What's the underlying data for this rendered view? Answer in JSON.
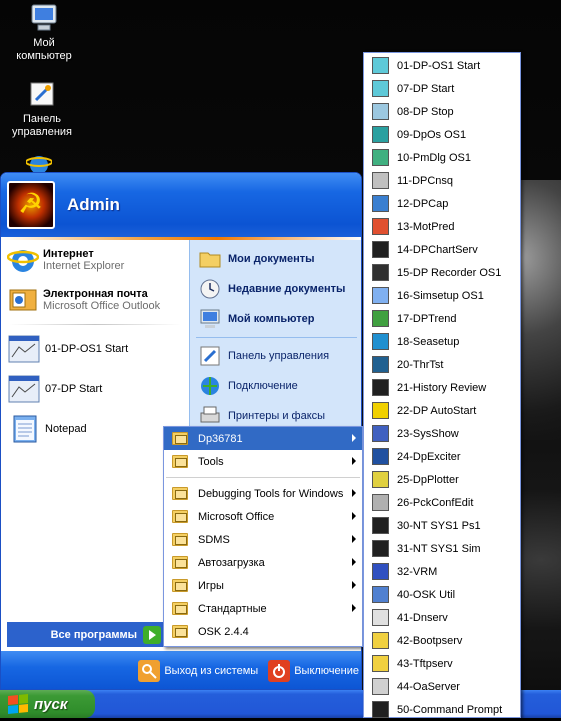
{
  "desktop": {
    "icons": [
      {
        "label": "Мой компьютер",
        "icon": "my-computer-icon"
      },
      {
        "label": "Панель управления",
        "icon": "control-panel-icon"
      }
    ]
  },
  "startmenu": {
    "user": "Admin",
    "pinned": [
      {
        "title": "Интернет",
        "subtitle": "Internet Explorer",
        "icon": "internet-explorer-icon"
      },
      {
        "title": "Электронная почта",
        "subtitle": "Microsoft Office Outlook",
        "icon": "outlook-icon"
      }
    ],
    "recent": [
      {
        "label": "01-DP-OS1 Start",
        "icon": "dp-window-icon"
      },
      {
        "label": "07-DP Start",
        "icon": "dp-window-icon"
      },
      {
        "label": "Notepad",
        "icon": "notepad-icon"
      }
    ],
    "right": {
      "bold": [
        {
          "label": "Мои документы",
          "icon": "my-documents-icon"
        },
        {
          "label": "Недавние документы",
          "icon": "recent-documents-icon"
        },
        {
          "label": "Мой компьютер",
          "icon": "my-computer-icon"
        }
      ],
      "normal": [
        {
          "label": "Панель управления",
          "icon": "control-panel-icon"
        },
        {
          "label": "Подключение",
          "icon": "connect-icon"
        },
        {
          "label": "Принтеры и факсы",
          "icon": "printer-icon"
        }
      ]
    },
    "all_programs": "Все программы",
    "logoff": "Выход из системы",
    "shutdown": "Выключение"
  },
  "taskbar": {
    "start_label": "пуск"
  },
  "programs": {
    "group1": [
      {
        "label": "Dp36781",
        "submenu": true,
        "selected": true
      },
      {
        "label": "Tools",
        "submenu": true
      }
    ],
    "group2": [
      {
        "label": "Debugging Tools for Windows",
        "submenu": true
      },
      {
        "label": "Microsoft Office",
        "submenu": true
      },
      {
        "label": "SDMS",
        "submenu": true
      },
      {
        "label": "Автозагрузка",
        "submenu": true
      },
      {
        "label": "Игры",
        "submenu": true
      },
      {
        "label": "Стандартные",
        "submenu": true
      },
      {
        "label": "OSK 2.4.4",
        "submenu": false
      }
    ]
  },
  "dp_items": [
    {
      "label": "01-DP-OS1 Start",
      "color": "#5ec9d8"
    },
    {
      "label": "07-DP Start",
      "color": "#5ec9d8"
    },
    {
      "label": "08-DP Stop",
      "color": "#9cc8e0"
    },
    {
      "label": "09-DpOs OS1",
      "color": "#2aa0a0"
    },
    {
      "label": "10-PmDlg OS1",
      "color": "#40b080"
    },
    {
      "label": "11-DPCnsq",
      "color": "#c0c0c0"
    },
    {
      "label": "12-DPCap",
      "color": "#3a7fd0"
    },
    {
      "label": "13-MotPred",
      "color": "#e05030"
    },
    {
      "label": "14-DPChartServ",
      "color": "#202020"
    },
    {
      "label": "15-DP Recorder OS1",
      "color": "#303030"
    },
    {
      "label": "16-Simsetup OS1",
      "color": "#80b0f0"
    },
    {
      "label": "17-DPTrend",
      "color": "#40a040"
    },
    {
      "label": "18-Seasetup",
      "color": "#2090d0"
    },
    {
      "label": "20-ThrTst",
      "color": "#206090"
    },
    {
      "label": "21-History Review",
      "color": "#202020"
    },
    {
      "label": "22-DP AutoStart",
      "color": "#f0d000"
    },
    {
      "label": "23-SysShow",
      "color": "#4060c0"
    },
    {
      "label": "24-DpExciter",
      "color": "#2050a0"
    },
    {
      "label": "25-DpPlotter",
      "color": "#e0d040"
    },
    {
      "label": "26-PckConfEdit",
      "color": "#b0b0b0"
    },
    {
      "label": "30-NT SYS1 Ps1",
      "color": "#202020"
    },
    {
      "label": "31-NT SYS1 Sim",
      "color": "#202020"
    },
    {
      "label": "32-VRM",
      "color": "#3050c0"
    },
    {
      "label": "40-OSK Util",
      "color": "#5080d0"
    },
    {
      "label": "41-Dnserv",
      "color": "#e0e0e0"
    },
    {
      "label": "42-Bootpserv",
      "color": "#f0d040"
    },
    {
      "label": "43-Tftpserv",
      "color": "#f0d040"
    },
    {
      "label": "44-OaServer",
      "color": "#d0d0d0"
    },
    {
      "label": "50-Command Prompt",
      "color": "#202020"
    }
  ]
}
